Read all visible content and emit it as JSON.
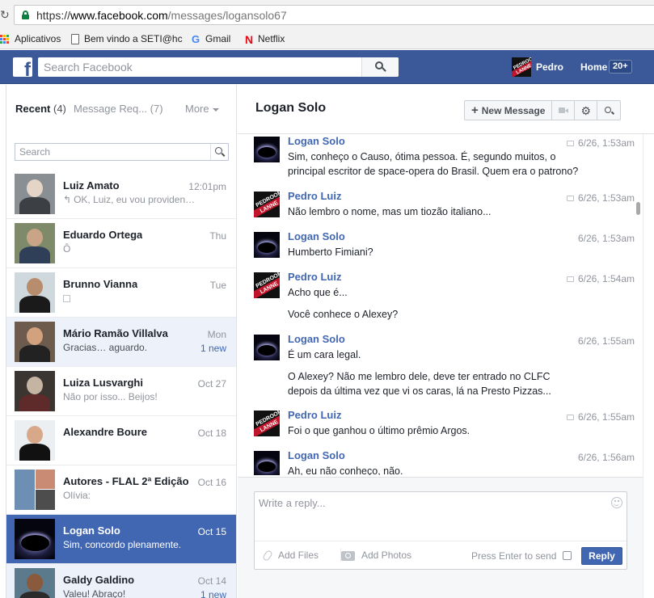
{
  "browser": {
    "url_scheme": "https://",
    "url_host": "www.facebook.com",
    "url_path": "/messages/logansolo67",
    "bookmarks": [
      {
        "label": "Aplicativos",
        "icon": "apps-grid-icon"
      },
      {
        "label": "Bem vindo a SETI@hc",
        "icon": "document-icon"
      },
      {
        "label": "Gmail",
        "icon": "google-icon"
      },
      {
        "label": "Netflix",
        "icon": "netflix-icon"
      }
    ]
  },
  "fb": {
    "search_placeholder": "Search Facebook",
    "user_name": "Pedro",
    "home_label": "Home",
    "home_badge": "20+",
    "brand_color": "#3b5998"
  },
  "left": {
    "recent_label": "Recent",
    "recent_count": "(4)",
    "requests_label": "Message Req... (7)",
    "more_label": "More",
    "search_placeholder": "Search",
    "threads": [
      {
        "name": "Luiz Amato",
        "snippet": "OK, Luiz, eu vou providen…",
        "time": "12:01pm",
        "new": "",
        "replied": true
      },
      {
        "name": "Eduardo Ortega",
        "snippet": "Ô",
        "time": "Thu",
        "new": ""
      },
      {
        "name": "Brunno Vianna",
        "snippet": "",
        "time": "Tue",
        "new": ""
      },
      {
        "name": "Mário Ramão Villalva",
        "snippet": "Gracias… aguardo.",
        "time": "Mon",
        "new": "1 new"
      },
      {
        "name": "Luiza Lusvarghi",
        "snippet": "Não por isso... Beijos!",
        "time": "Oct 27",
        "new": ""
      },
      {
        "name": "Alexandre Boure",
        "snippet": "",
        "time": "Oct 18",
        "new": ""
      },
      {
        "name": "Autores - FLAL 2ª Edição",
        "snippet": "Olívia:",
        "time": "Oct 16",
        "new": ""
      },
      {
        "name": "Logan Solo",
        "snippet": "Sim, concordo plenamente.",
        "time": "Oct 15",
        "new": ""
      },
      {
        "name": "Galdy Galdino",
        "snippet": "Valeu! Abraço!",
        "time": "Oct 14",
        "new": "1 new"
      }
    ]
  },
  "conversation": {
    "title": "Logan Solo",
    "new_message_label": "New Message",
    "messages": [
      {
        "sender": "Logan Solo",
        "time": "6/26, 1:53am",
        "seen_icon": true,
        "lines": [
          "Sim, conheço o Causo, ótima pessoa. É, segundo muitos, o",
          "principal escritor de space-opera do Brasil. Quem era o patrono?"
        ]
      },
      {
        "sender": "Pedro Luiz",
        "time": "6/26, 1:53am",
        "seen_icon": true,
        "lines": [
          "Não lembro o nome, mas um tiozão italiano..."
        ]
      },
      {
        "sender": "Logan Solo",
        "time": "6/26, 1:53am",
        "seen_icon": false,
        "lines": [
          "Humberto Fimiani?"
        ]
      },
      {
        "sender": "Pedro Luiz",
        "time": "6/26, 1:54am",
        "seen_icon": true,
        "lines": [
          "Acho que é...",
          "",
          "Você conhece o Alexey?"
        ]
      },
      {
        "sender": "Logan Solo",
        "time": "6/26, 1:55am",
        "seen_icon": false,
        "lines": [
          "É um cara legal.",
          "",
          "O Alexey? Não me lembro dele, deve ter entrado no CLFC",
          "depois da última vez que vi os caras, lá na Presto Pizzas..."
        ]
      },
      {
        "sender": "Pedro Luiz",
        "time": "6/26, 1:55am",
        "seen_icon": true,
        "lines": [
          "Foi o que ganhou o último prêmio Argos."
        ]
      },
      {
        "sender": "Logan Solo",
        "time": "6/26, 1:56am",
        "seen_icon": false,
        "lines": [
          "Ah, eu não conheço, não."
        ]
      }
    ]
  },
  "composer": {
    "placeholder": "Write a reply...",
    "add_files_label": "Add Files",
    "add_photos_label": "Add Photos",
    "press_enter_label": "Press Enter to send",
    "reply_label": "Reply"
  }
}
